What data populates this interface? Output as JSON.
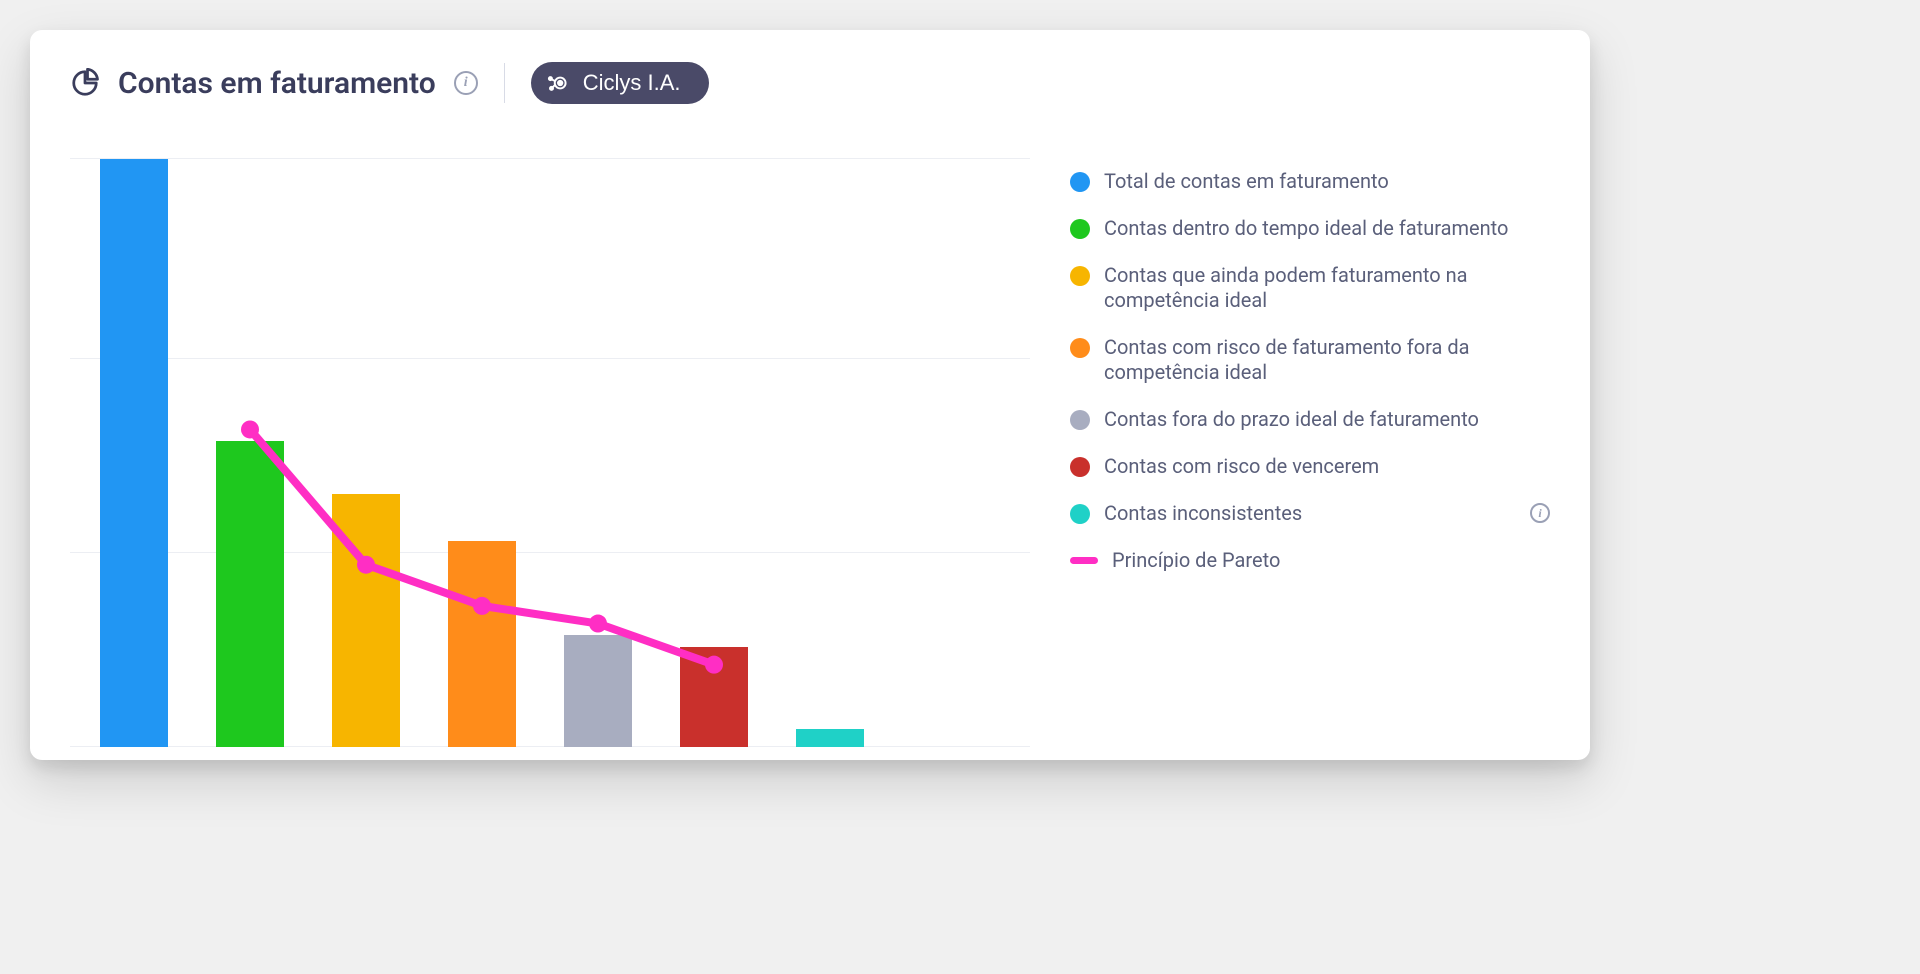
{
  "header": {
    "title": "Contas em faturamento",
    "pill_label": "Ciclys I.A."
  },
  "legend": [
    {
      "label": "Total de contas em faturamento",
      "color": "#2196f3",
      "type": "dot"
    },
    {
      "label": "Contas dentro do tempo ideal de faturamento",
      "color": "#1ec81e",
      "type": "dot"
    },
    {
      "label": "Contas que ainda podem faturamento na competência ideal",
      "color": "#f7b500",
      "type": "dot"
    },
    {
      "label": "Contas com risco de faturamento fora da competência ideal",
      "color": "#ff8c1a",
      "type": "dot"
    },
    {
      "label": "Contas fora do prazo ideal de faturamento",
      "color": "#a8adc0",
      "type": "dot"
    },
    {
      "label": "Contas com risco de vencerem",
      "color": "#c9302c",
      "type": "dot"
    },
    {
      "label": "Contas inconsistentes",
      "color": "#1fd1c7",
      "type": "dot",
      "info": true
    },
    {
      "label": "Princípio de Pareto",
      "color": "#ff2ec4",
      "type": "dash"
    }
  ],
  "chart_data": {
    "type": "bar+line",
    "title": "Contas em faturamento",
    "ylim": [
      0,
      100
    ],
    "grid_y": [
      0,
      33,
      66,
      100
    ],
    "categories": [
      "Total de contas em faturamento",
      "Contas dentro do tempo ideal de faturamento",
      "Contas que ainda podem faturamento na competência ideal",
      "Contas com risco de faturamento fora da competência ideal",
      "Contas fora do prazo ideal de faturamento",
      "Contas com risco de vencerem",
      "Contas inconsistentes"
    ],
    "bars": {
      "values": [
        100,
        52,
        43,
        35,
        19,
        17,
        3
      ],
      "colors": [
        "#2196f3",
        "#1ec81e",
        "#f7b500",
        "#ff8c1a",
        "#a8adc0",
        "#c9302c",
        "#1fd1c7"
      ]
    },
    "line": {
      "name": "Princípio de Pareto",
      "color": "#ff2ec4",
      "x_indices": [
        1,
        2,
        3,
        4,
        5
      ],
      "values": [
        54,
        31,
        24,
        21,
        14
      ]
    }
  }
}
